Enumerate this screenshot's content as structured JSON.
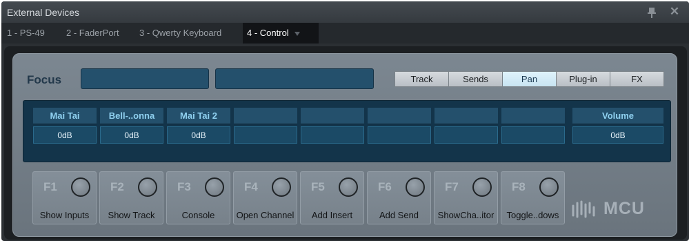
{
  "window": {
    "title": "External Devices"
  },
  "tabs": [
    {
      "label": "1 - PS-49",
      "active": false
    },
    {
      "label": "2 - FaderPort",
      "active": false
    },
    {
      "label": "3 - Qwerty Keyboard",
      "active": false
    },
    {
      "label": "4 - Control",
      "active": true
    }
  ],
  "focus": {
    "label": "Focus",
    "field_1": "",
    "field_2": ""
  },
  "modes": [
    {
      "label": "Track",
      "active": false
    },
    {
      "label": "Sends",
      "active": false
    },
    {
      "label": "Pan",
      "active": true
    },
    {
      "label": "Plug-in",
      "active": false
    },
    {
      "label": "FX",
      "active": false
    }
  ],
  "channels": [
    {
      "name": "Mai Tai",
      "value": "0dB"
    },
    {
      "name": "Bell-..onna",
      "value": "0dB"
    },
    {
      "name": "Mai Tai 2",
      "value": "0dB"
    },
    {
      "name": "",
      "value": ""
    },
    {
      "name": "",
      "value": ""
    },
    {
      "name": "",
      "value": ""
    },
    {
      "name": "",
      "value": ""
    },
    {
      "name": "",
      "value": ""
    }
  ],
  "master": {
    "name": "Volume",
    "value": "0dB"
  },
  "function_keys": [
    {
      "id": "F1",
      "label": "Show Inputs"
    },
    {
      "id": "F2",
      "label": "Show Track"
    },
    {
      "id": "F3",
      "label": "Console"
    },
    {
      "id": "F4",
      "label": "Open Channel"
    },
    {
      "id": "F5",
      "label": "Add Insert"
    },
    {
      "id": "F6",
      "label": "Add Send"
    },
    {
      "id": "F7",
      "label": "ShowCha..itor"
    },
    {
      "id": "F8",
      "label": "Toggle..dows"
    }
  ],
  "logo": {
    "text": "MCU"
  },
  "colors": {
    "accent": "#8fd0ef",
    "panel": "#7c8791",
    "strip": "#13344a"
  }
}
